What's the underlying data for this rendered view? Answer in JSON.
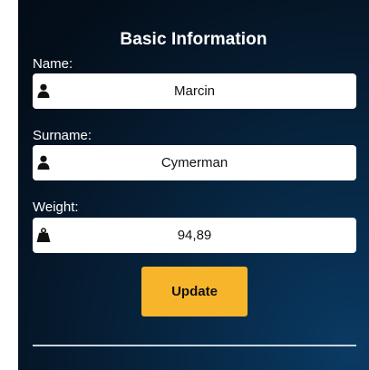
{
  "form": {
    "title": "Basic Information",
    "fields": [
      {
        "label": "Name:",
        "value": "Marcin",
        "icon": "user-icon"
      },
      {
        "label": "Surname:",
        "value": "Cymerman",
        "icon": "user-icon"
      },
      {
        "label": "Weight:",
        "value": "94,89",
        "icon": "weight-icon"
      }
    ],
    "update_label": "Update"
  },
  "colors": {
    "button": "#f7b52c",
    "panel_dark": "#030c17",
    "panel_accent": "#0a3a63",
    "input_bg": "#ffffff"
  }
}
